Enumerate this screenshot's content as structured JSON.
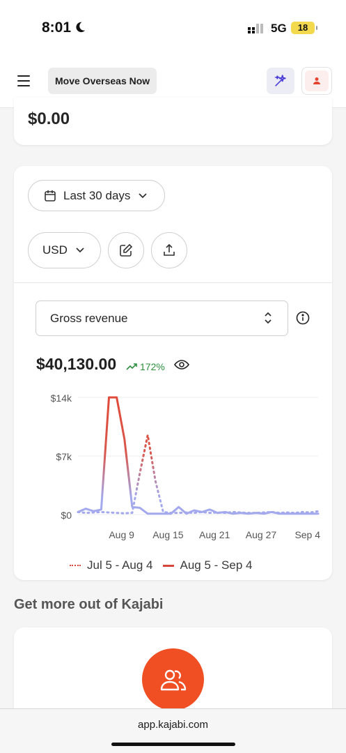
{
  "status_bar": {
    "time": "8:01",
    "network": "5G",
    "battery": "18"
  },
  "nav": {
    "site_name": "Move Overseas Now"
  },
  "prev_card": {
    "amount": "$0.00"
  },
  "filters": {
    "date_range": "Last 30 days",
    "currency": "USD"
  },
  "metric": {
    "selected": "Gross revenue",
    "total": "$40,130.00",
    "change": "172%"
  },
  "chart_data": {
    "type": "line",
    "y_tick_labels": [
      "$14k",
      "$7k",
      "$0"
    ],
    "x_tick_labels": [
      "Aug 9",
      "Aug 15",
      "Aug 21",
      "Aug 27",
      "Sep 4"
    ],
    "ylim": [
      0,
      15000
    ],
    "series": [
      {
        "name": "Jul 5 - Aug 4",
        "style": "dotted",
        "color": "#d4473c",
        "values": [
          300,
          200,
          250,
          300,
          250,
          200,
          150,
          200,
          5000,
          9500,
          4000,
          300,
          200,
          200,
          250,
          200,
          300,
          200,
          250,
          200,
          300,
          250,
          200,
          200,
          250,
          300,
          200,
          250,
          200,
          300,
          250,
          400
        ]
      },
      {
        "name": "Aug 5 - Sep 4",
        "style": "solid",
        "color": "#d4473c",
        "values": [
          300,
          700,
          400,
          600,
          14000,
          14000,
          9000,
          900,
          800,
          100,
          100,
          100,
          100,
          900,
          100,
          500,
          300,
          600,
          200,
          300,
          100,
          200,
          100,
          200,
          100,
          300,
          100,
          100,
          100,
          100,
          100,
          100
        ]
      }
    ],
    "grid": true
  },
  "legend": {
    "series_1": "Jul 5 - Aug 4",
    "series_2": "Aug 5 - Sep 4"
  },
  "promo": {
    "section_title": "Get more out of Kajabi"
  },
  "browser": {
    "url": "app.kajabi.com"
  },
  "colors": {
    "accent_orange": "#f04e23",
    "trend_green": "#2e8f3e",
    "line_red": "#d4473c",
    "line_purple": "#a3a9ec"
  }
}
